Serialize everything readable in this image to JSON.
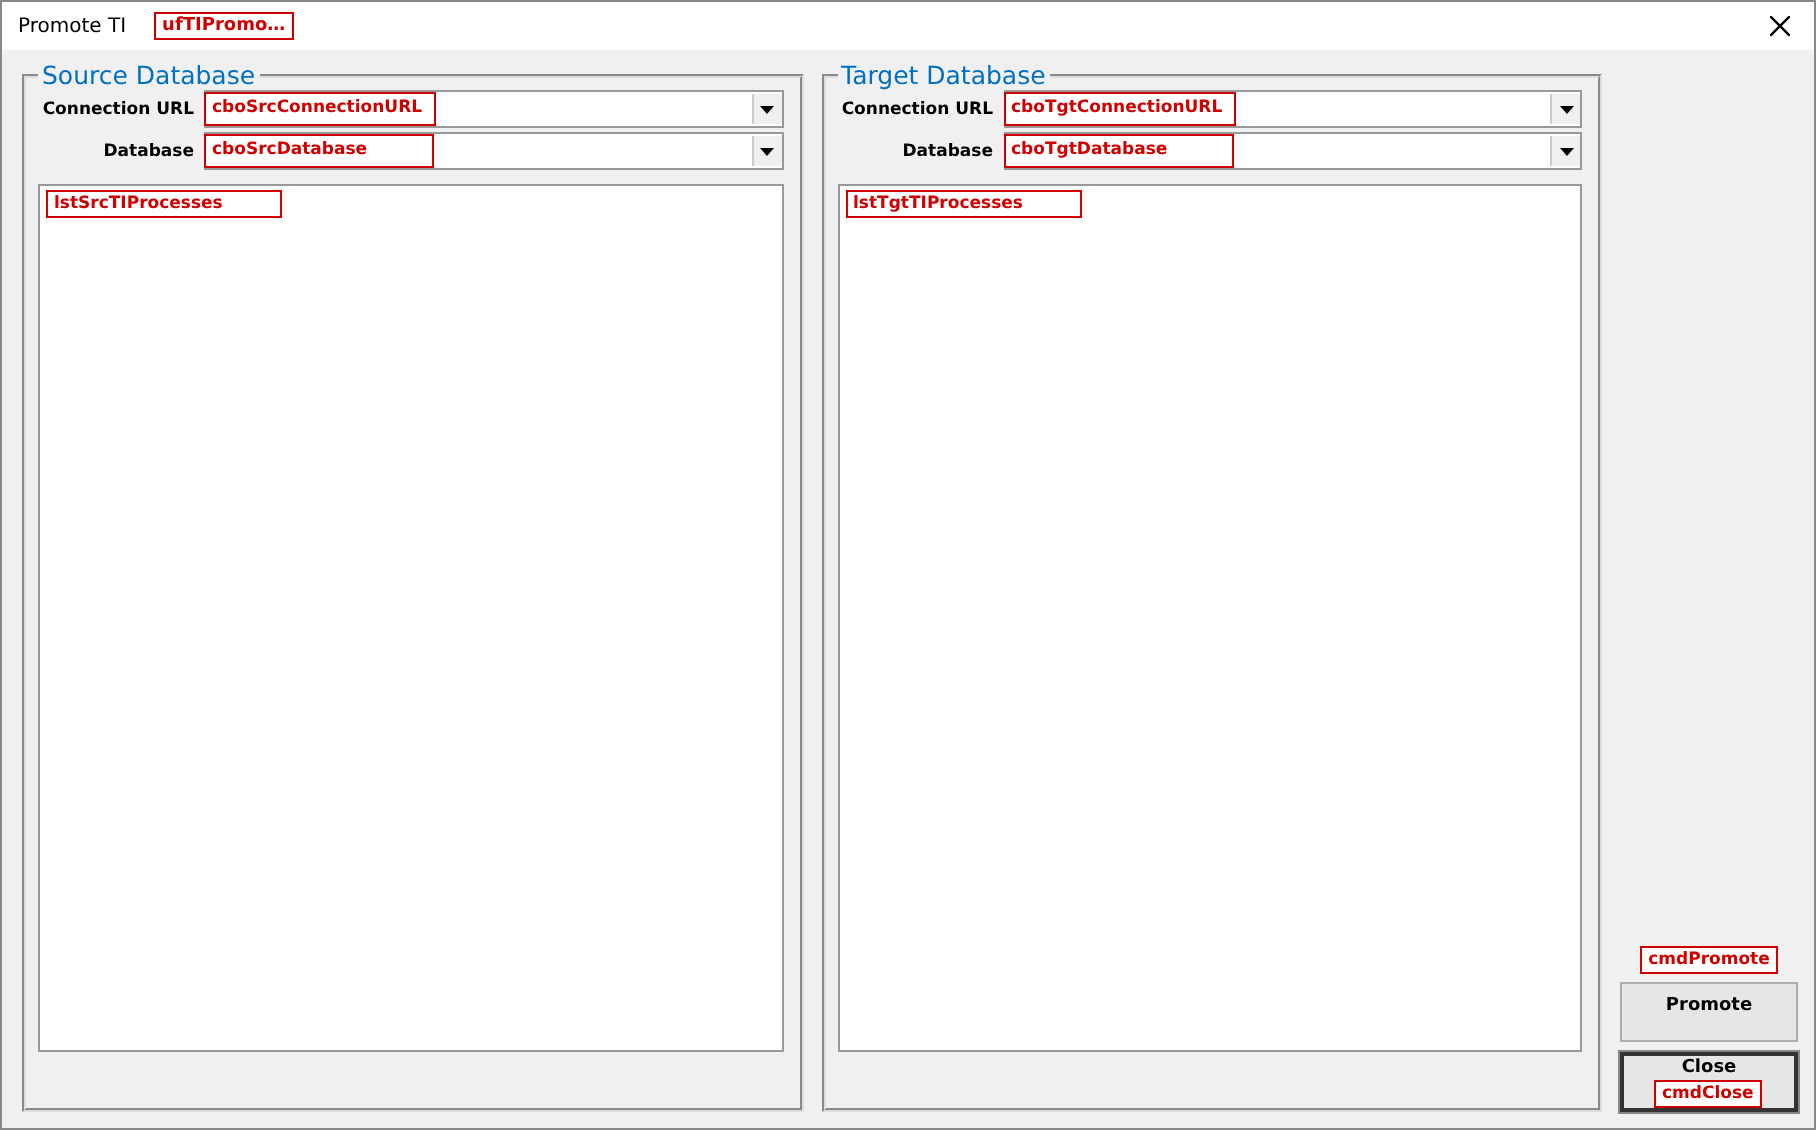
{
  "window": {
    "title": "Promote TI",
    "tag": "ufTIPromo…"
  },
  "panels": [
    {
      "title": "Source Database",
      "fields": [
        {
          "label": "Connection URL",
          "tag": "cboSrcConnectionURL"
        },
        {
          "label": "Database",
          "tag": "cboSrcDatabase"
        }
      ],
      "list_tag": "lstSrcTIProcesses"
    },
    {
      "title": "Target Database",
      "fields": [
        {
          "label": "Connection URL",
          "tag": "cboTgtConnectionURL"
        },
        {
          "label": "Database",
          "tag": "cboTgtDatabase"
        }
      ],
      "list_tag": "lstTgtTIProcesses"
    }
  ],
  "buttons": [
    {
      "label": "Promote",
      "tag": "cmdPromote",
      "focused": false
    },
    {
      "label": "Close",
      "tag": "cmdClose",
      "focused": true
    }
  ]
}
